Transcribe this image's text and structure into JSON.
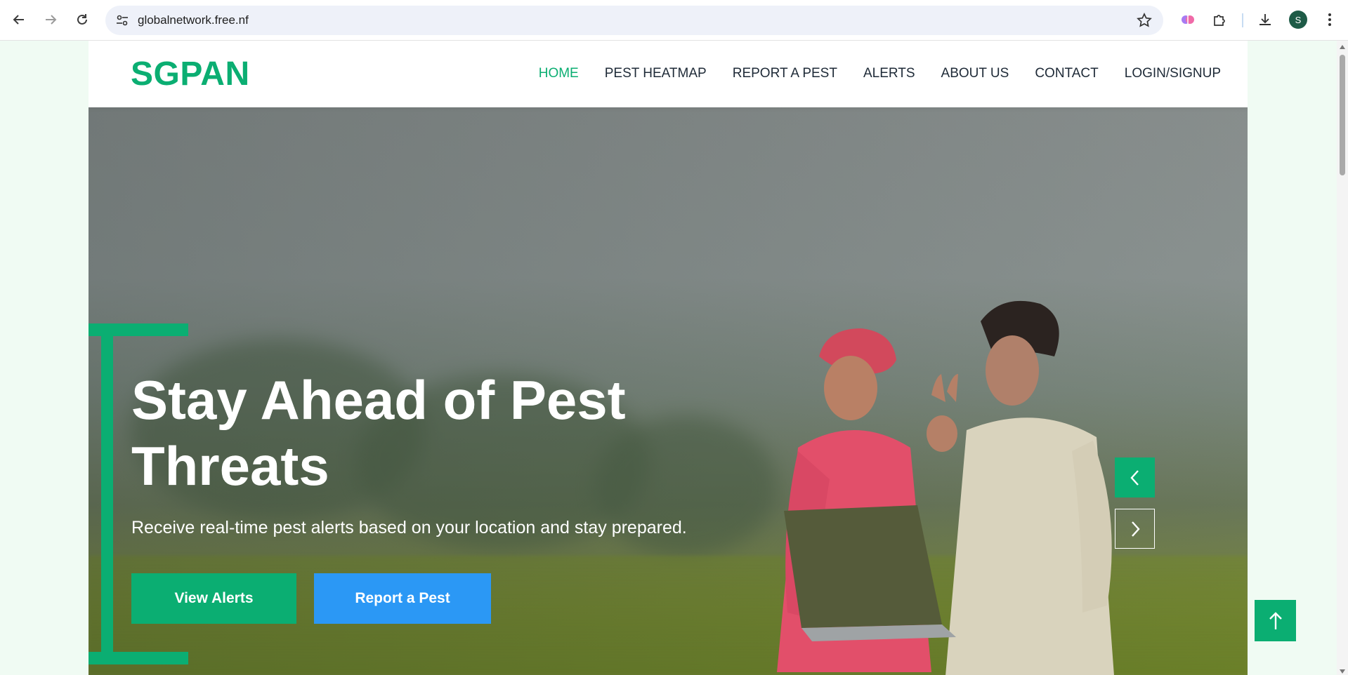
{
  "browser": {
    "url": "globalnetwork.free.nf",
    "profile_initial": "S",
    "icons": [
      "back-icon",
      "forward-icon",
      "reload-icon",
      "site-settings-icon",
      "bookmark-star-icon",
      "extension-brain-icon",
      "extensions-puzzle-icon",
      "download-icon",
      "profile-avatar",
      "more-menu-icon"
    ]
  },
  "site": {
    "logo": "SGPAN",
    "nav": [
      {
        "label": "HOME",
        "active": true
      },
      {
        "label": "PEST HEATMAP",
        "active": false
      },
      {
        "label": "REPORT A PEST",
        "active": false
      },
      {
        "label": "ALERTS",
        "active": false
      },
      {
        "label": "ABOUT US",
        "active": false
      },
      {
        "label": "CONTACT",
        "active": false
      },
      {
        "label": "LOGIN/SIGNUP",
        "active": false
      }
    ]
  },
  "hero": {
    "title": "Stay Ahead of Pest Threats",
    "subtitle": "Receive real-time pest alerts based on your location and stay prepared.",
    "primary_button": "View Alerts",
    "secondary_button": "Report a Pest"
  },
  "colors": {
    "brand_green": "#0bae72",
    "button_blue": "#2b98f5",
    "page_bg": "#f0fbf3"
  }
}
